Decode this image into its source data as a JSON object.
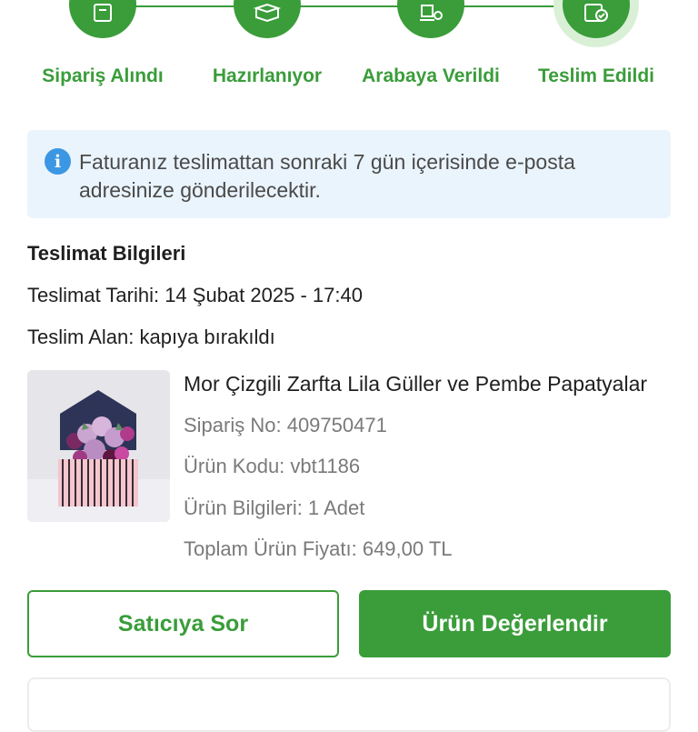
{
  "stepper": {
    "steps": [
      {
        "label": "Sipariş Alındı",
        "icon": "receipt-icon"
      },
      {
        "label": "Hazırlanıyor",
        "icon": "box-icon"
      },
      {
        "label": "Arabaya Verildi",
        "icon": "delivery-icon"
      },
      {
        "label": "Teslim Edildi",
        "icon": "delivered-check-icon"
      }
    ],
    "active_step": 4,
    "color": "#3a9d3a"
  },
  "info": {
    "icon": "info-icon",
    "text": "Faturanız teslimattan sonraki 7 gün içerisinde e-posta adresinize gönderilecektir."
  },
  "delivery": {
    "heading": "Teslimat Bilgileri",
    "date_line": "Teslimat Tarihi: 14 Şubat 2025 - 17:40",
    "receiver_line": "Teslim Alan: kapıya bırakıldı"
  },
  "product": {
    "title": "Mor Çizgili Zarfta Lila Güller ve Pembe Papatyalar",
    "order_no": "Sipariş No: 409750471",
    "product_code": "Ürün Kodu: vbt1186",
    "info": "Ürün Bilgileri: 1 Adet",
    "total_price": "Toplam Ürün Fiyatı: 649,00 TL"
  },
  "actions": {
    "ask_seller": "Satıcıya Sor",
    "rate_product": "Ürün Değerlendir"
  }
}
